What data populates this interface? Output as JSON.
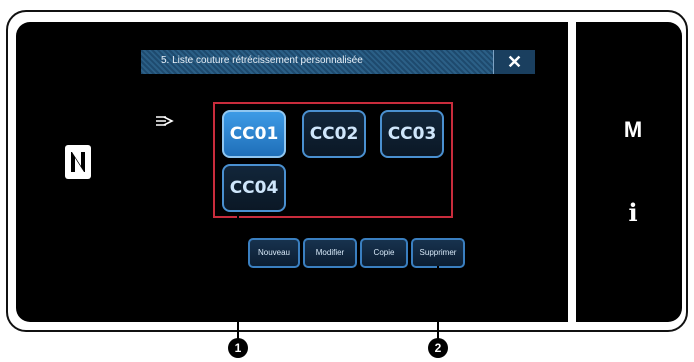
{
  "dialog": {
    "title": "5. Liste couture rétrécissement personnalisée",
    "close_glyph": "✕"
  },
  "patterns": [
    {
      "label": "CC01",
      "selected": true
    },
    {
      "label": "CC02",
      "selected": false
    },
    {
      "label": "CC03",
      "selected": false
    },
    {
      "label": "CC04",
      "selected": false
    }
  ],
  "actions": {
    "new": "Nouveau",
    "edit": "Modifier",
    "copy": "Copie",
    "delete": "Supprimer"
  },
  "side_panel": {
    "mode_label": "M",
    "info_label": "i"
  },
  "callouts": {
    "one": "1",
    "two": "2"
  },
  "colors": {
    "highlight_frame": "#c92c3c",
    "selected_button": "#3d9be6",
    "titlebar": "#2b5f86"
  },
  "icons": [
    "nfc-icon",
    "stitch-pattern-icon",
    "close-icon"
  ]
}
